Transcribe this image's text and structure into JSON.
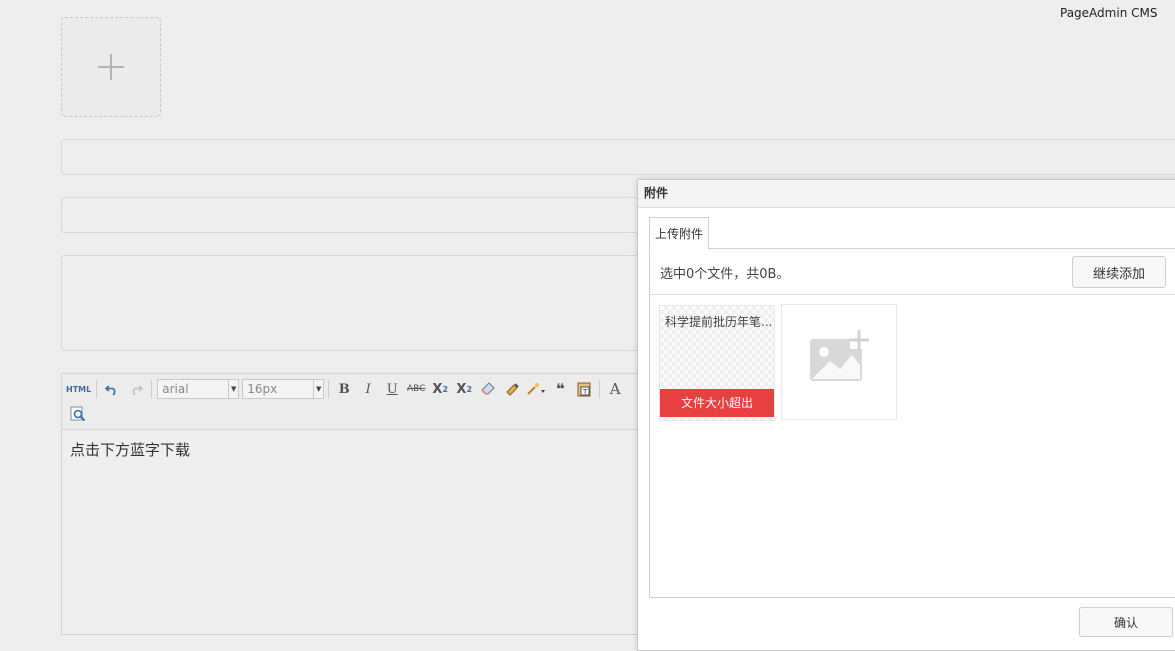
{
  "header": {
    "brand": "PageAdmin CMS"
  },
  "upload": {
    "icon": "plus-icon"
  },
  "editor": {
    "toolbar": {
      "html_label": "HTML",
      "font_family": "arial",
      "font_size": "16px",
      "icons": [
        "html-icon",
        "undo-icon",
        "redo-icon",
        "bold-icon",
        "italic-icon",
        "underline-icon",
        "strikethrough-icon",
        "superscript-icon",
        "subscript-icon",
        "eraser-icon",
        "format-painter-icon",
        "magic-wand-icon",
        "quote-icon",
        "paste-text-icon",
        "font-color-icon",
        "search-replace-icon"
      ]
    },
    "content": "点击下方蓝字下载"
  },
  "dialog": {
    "title": "附件",
    "tab": "上传附件",
    "status": "选中0个文件，共0B。",
    "add_button": "继续添加",
    "file": {
      "name": "科学提前批历年笔...",
      "error": "文件大小超出"
    },
    "confirm_button": "确认"
  },
  "colors": {
    "error": "#e84040",
    "link": "#3a6ea5"
  }
}
